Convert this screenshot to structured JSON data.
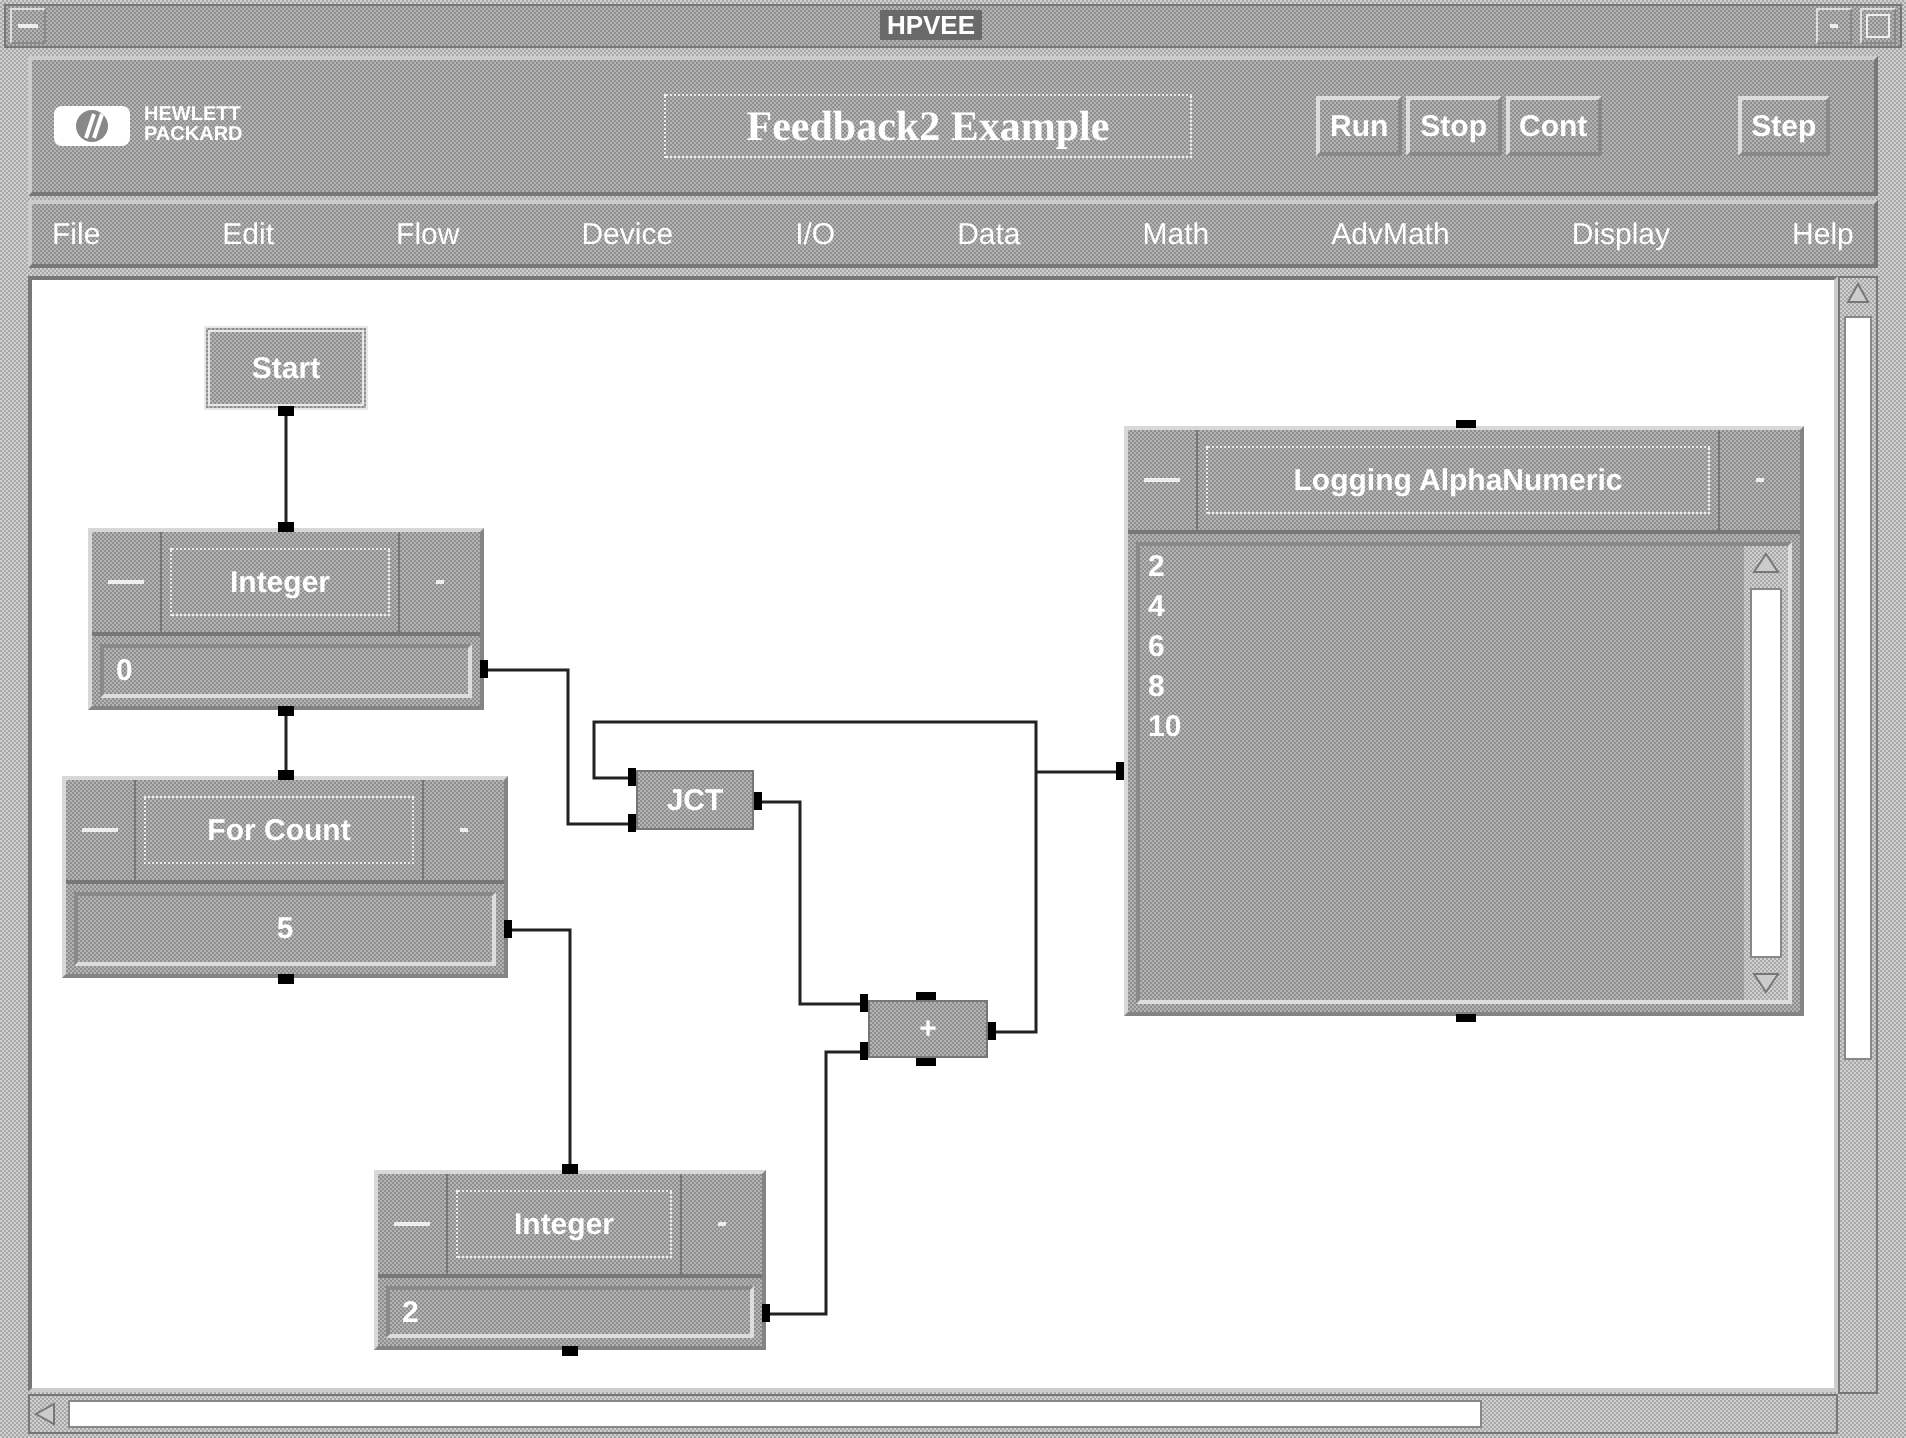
{
  "window": {
    "title": "HPVEE"
  },
  "header": {
    "logo_lines": [
      "HEWLETT",
      "PACKARD"
    ],
    "program_title": "Feedback2 Example",
    "buttons": [
      {
        "label": "Run"
      },
      {
        "label": "Stop"
      },
      {
        "label": "Cont"
      },
      {
        "label": "Step"
      }
    ]
  },
  "menu": [
    "File",
    "Edit",
    "Flow",
    "Device",
    "I/O",
    "Data",
    "Math",
    "AdvMath",
    "Display",
    "Help"
  ],
  "diagram": {
    "objects": [
      {
        "kind": "button",
        "title": "Start"
      },
      {
        "kind": "constant",
        "title": "Integer",
        "value": "0"
      },
      {
        "kind": "counter",
        "title": "For Count",
        "value": "5"
      },
      {
        "kind": "junction",
        "title": "JCT"
      },
      {
        "kind": "operator",
        "title": "+"
      },
      {
        "kind": "constant",
        "title": "Integer",
        "value": "2"
      },
      {
        "kind": "log",
        "title": "Logging AlphaNumeric",
        "lines": [
          "2",
          "4",
          "6",
          "8",
          "10"
        ]
      }
    ]
  }
}
